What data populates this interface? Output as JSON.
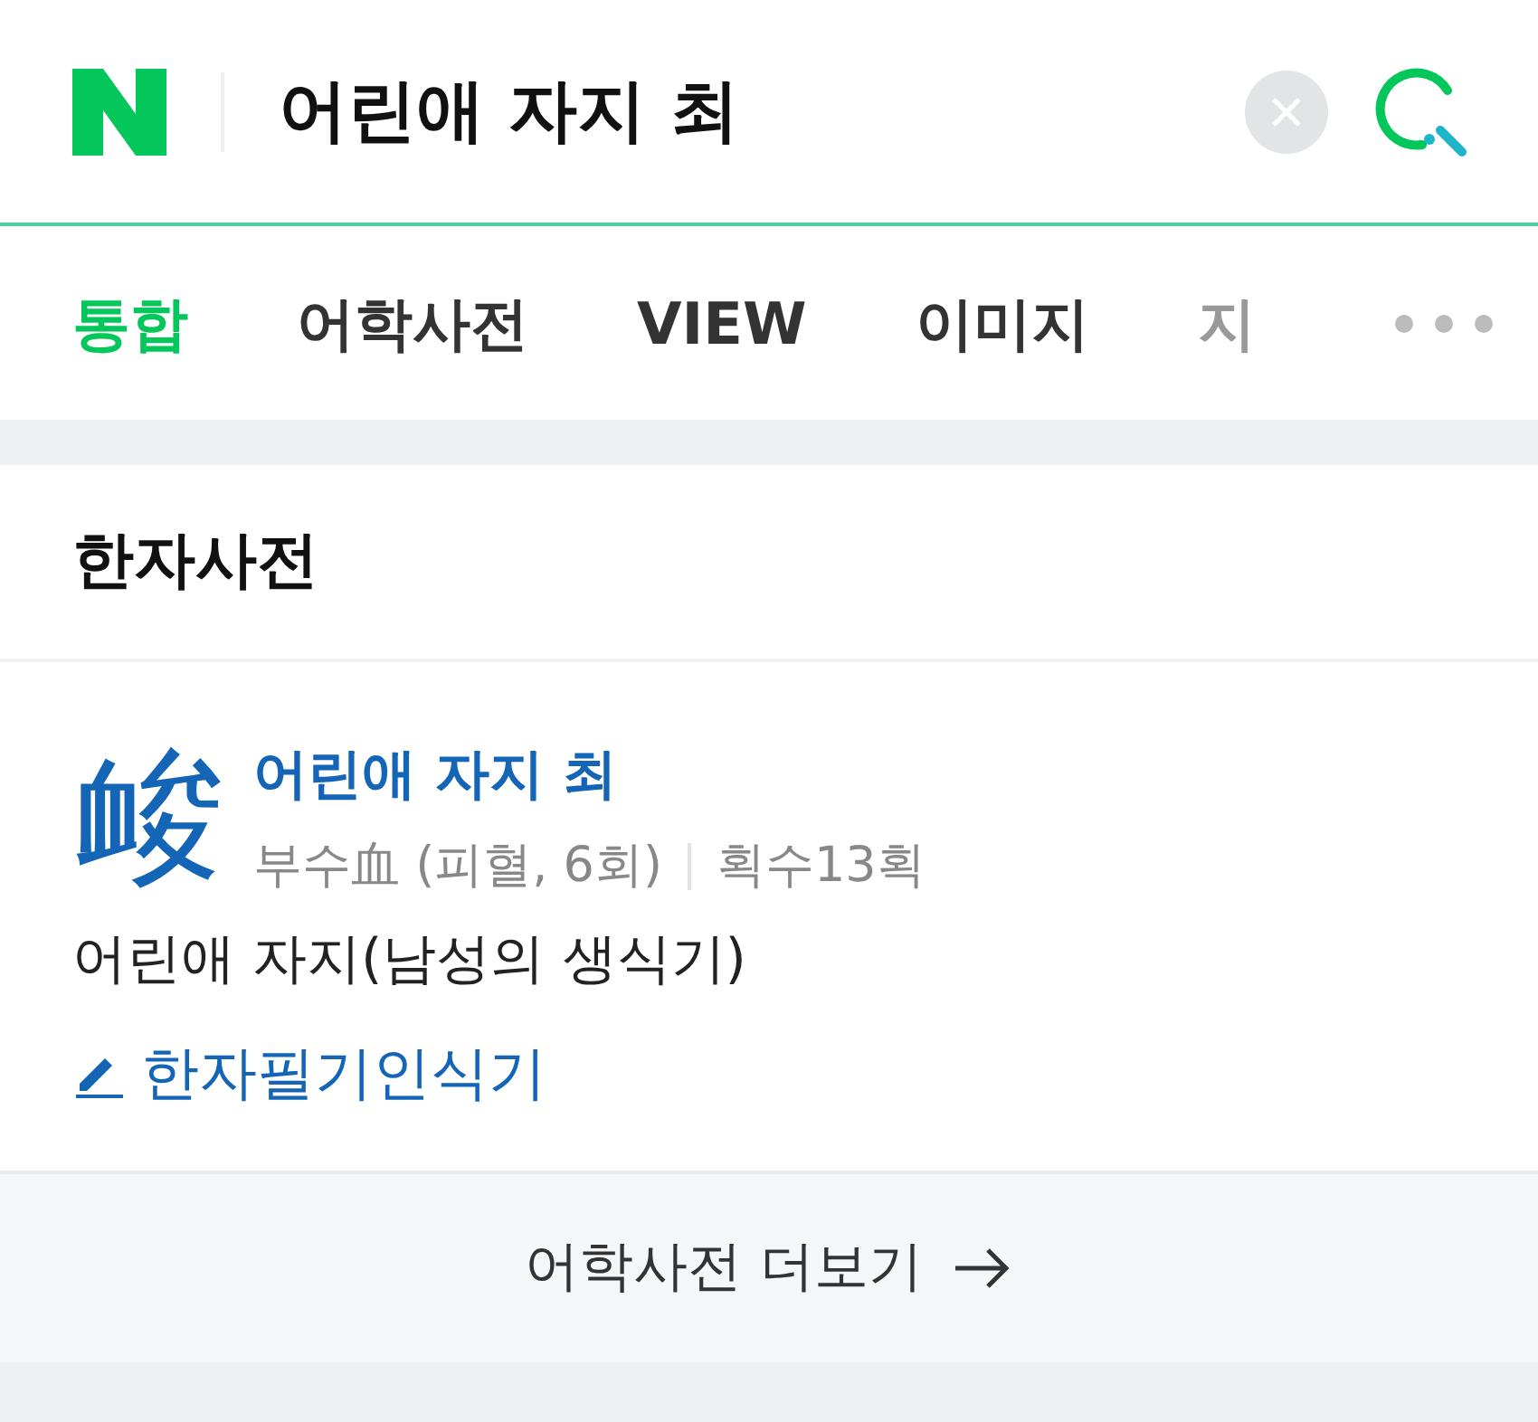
{
  "search": {
    "query": "어린애 자지 최"
  },
  "tabs": [
    {
      "label": "통합",
      "selected": true
    },
    {
      "label": "어학사전",
      "selected": false
    },
    {
      "label": "VIEW",
      "selected": false
    },
    {
      "label": "이미지",
      "selected": false
    },
    {
      "label": "지",
      "selected": false
    }
  ],
  "section": {
    "title": "한자사전",
    "entry": {
      "hanja": "䘒",
      "meaning_title": "어린애 자지 최",
      "radical": "부수血 (피혈, 6회)",
      "strokes": "획수13획",
      "definition": "어린애 자지(남성의 생식기)",
      "handwriting_link": "한자필기인식기"
    },
    "more_link": "어학사전 더보기"
  }
}
